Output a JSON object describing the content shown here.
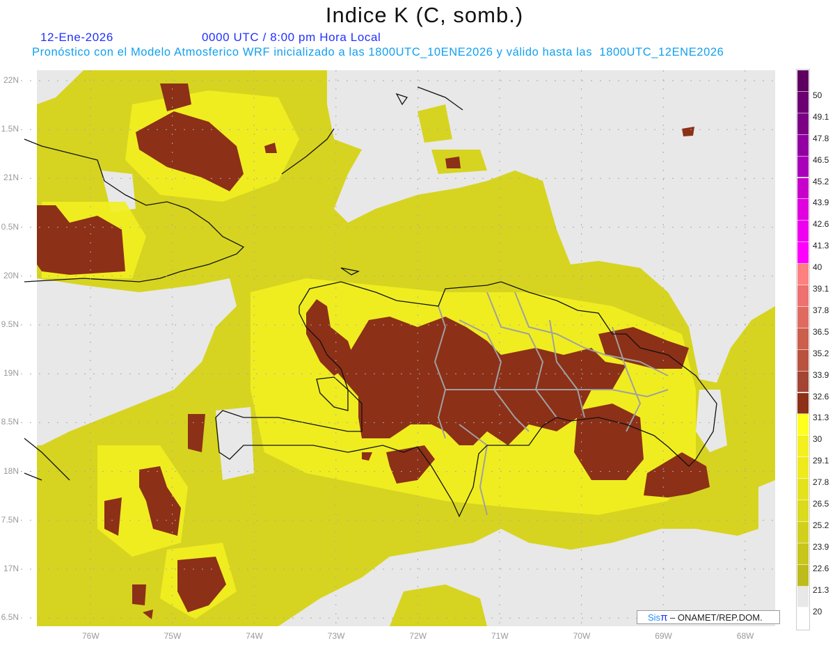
{
  "header": {
    "title": "Indice K (C, somb.)",
    "date": "12-Ene-2026",
    "time": "0000 UTC / 8:00 pm Hora Local",
    "model_line": "Pronóstico con el Modelo Atmosferico WRF inicializado a las 1800UTC_10ENE2026 y válido hasta las  1800UTC_12ENE2026"
  },
  "axes": {
    "lon_labels": [
      "76W",
      "75W",
      "74W",
      "73W",
      "72W",
      "71W",
      "70W",
      "69W",
      "68W"
    ],
    "lat_labels": [
      "22N",
      "1.5N",
      "21N",
      "0.5N",
      "20N",
      "9.5N",
      "19N",
      "8.5N",
      "18N",
      "7.5N",
      "17N",
      "6.5N"
    ]
  },
  "colorbar": {
    "labels": [
      "50",
      "49.1",
      "47.8",
      "46.5",
      "45.2",
      "43.9",
      "42.6",
      "41.3",
      "40",
      "39.1",
      "37.8",
      "36.5",
      "35.2",
      "33.9",
      "32.6",
      "31.3",
      "30",
      "29.1",
      "27.8",
      "26.5",
      "25.2",
      "23.9",
      "22.6",
      "21.3",
      "20"
    ],
    "colors": [
      "#5e0060",
      "#6c0072",
      "#7c0084",
      "#9200a2",
      "#aa00ba",
      "#c800cc",
      "#e000e0",
      "#f000f0",
      "#ff00ff",
      "#ff8080",
      "#ee7070",
      "#e06a60",
      "#cc5e4c",
      "#ba5240",
      "#a44434",
      "#8c3018",
      "#ffff20",
      "#f4f020",
      "#eeea1c",
      "#e4e21c",
      "#dcda1c",
      "#d2d01c",
      "#c8c61c",
      "#bebc1c",
      "#e8e8e8"
    ]
  },
  "credit": {
    "sis": "Sis",
    "pi": "π",
    "rest": " –  ONAMET/REP.DOM."
  },
  "colors": {
    "no_data": "#e8e8e8",
    "land_border": "#000000",
    "province_border": "#a0a0a0"
  }
}
